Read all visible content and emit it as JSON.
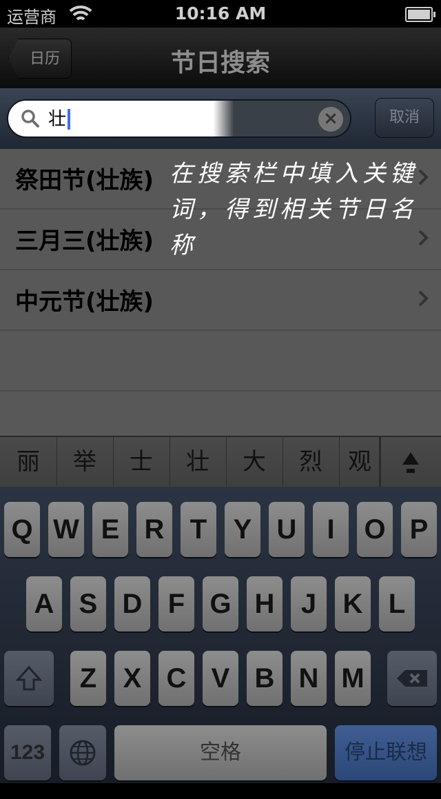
{
  "status_bar": {
    "carrier": "运营商",
    "time": "10:16 AM"
  },
  "nav": {
    "back_label": "日历",
    "title": "节日搜索"
  },
  "search": {
    "query": "壮",
    "cancel_label": "取消"
  },
  "results": [
    {
      "label": "祭田节(壮族)"
    },
    {
      "label": "三月三(壮族)"
    },
    {
      "label": "中元节(壮族)"
    }
  ],
  "annotation": {
    "text": "在搜索栏中填入关键词，得到相关节日名称"
  },
  "candidates": [
    "丽",
    "举",
    "士",
    "壮",
    "大",
    "烈",
    "观"
  ],
  "keyboard": {
    "row1": [
      "Q",
      "W",
      "E",
      "R",
      "T",
      "Y",
      "U",
      "I",
      "O",
      "P"
    ],
    "row2": [
      "A",
      "S",
      "D",
      "F",
      "G",
      "H",
      "J",
      "K",
      "L"
    ],
    "row3": [
      "Z",
      "X",
      "C",
      "V",
      "B",
      "N",
      "M"
    ],
    "num_label": "123",
    "space_label": "空格",
    "confirm_label": "停止联想"
  },
  "colors": {
    "confirm_key": "#3f5e92",
    "cursor": "#3b6ee8"
  }
}
